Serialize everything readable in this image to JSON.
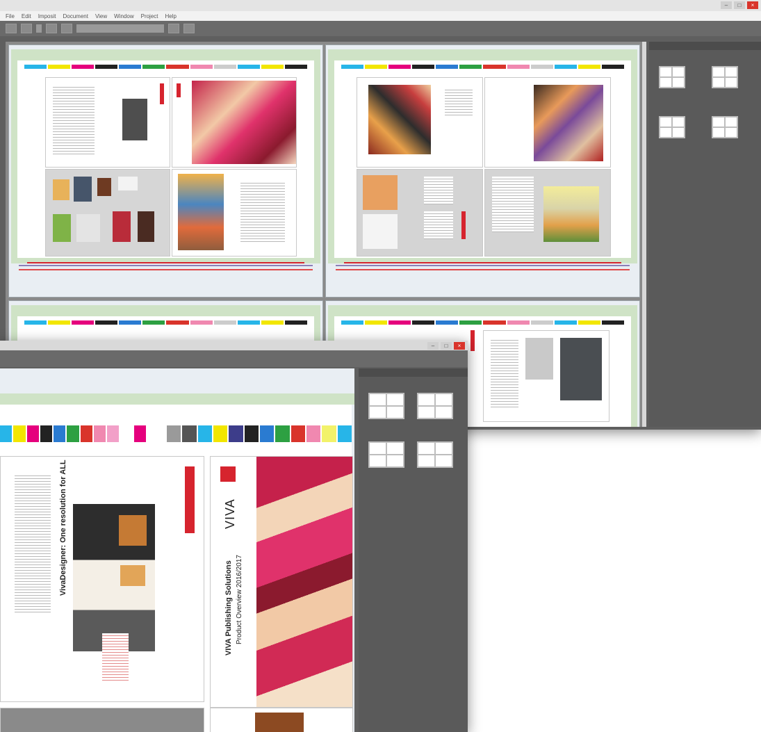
{
  "back_window": {
    "title": "",
    "menu": [
      "File",
      "Edit",
      "Imposit",
      "Document",
      "View",
      "Window",
      "Project",
      "Help"
    ],
    "toolbar": {
      "zoom": "",
      "document": ""
    },
    "panel": {
      "title": "",
      "layouts": [
        {
          "label": "",
          "cells": [
            "",
            "",
            "",
            ""
          ]
        },
        {
          "label": "",
          "cells": [
            "",
            "",
            "",
            ""
          ]
        },
        {
          "label": "",
          "cells": [
            "",
            "",
            "",
            ""
          ]
        },
        {
          "label": "",
          "cells": [
            "",
            "",
            "",
            ""
          ]
        }
      ]
    },
    "sheet_info": [
      "",
      ""
    ]
  },
  "front_window": {
    "title": "",
    "panel": {
      "title": "",
      "layouts": [
        {
          "label": "",
          "cells": [
            "",
            "",
            "",
            ""
          ]
        },
        {
          "label": "",
          "cells": [
            "",
            "",
            "",
            ""
          ]
        },
        {
          "label": "",
          "cells": [
            "",
            "",
            "",
            ""
          ]
        },
        {
          "label": "",
          "cells": [
            "",
            "",
            "",
            ""
          ]
        }
      ]
    },
    "page_text": {
      "heading": "VivaDesigner: One resolution for ALL",
      "logo": "VIVA",
      "cover_title": "VIVA Publishing Solutions",
      "cover_subtitle": "Product Overview 2016/2017"
    }
  },
  "colors": {
    "app_gray": "#5f5f5f",
    "sheet_green": "#cfe3c6",
    "sheet_blue": "#e9eef3",
    "accent_red": "#d6242e",
    "close_red": "#d9342b"
  },
  "colorbar_colors": [
    "#27b5e8",
    "#f2e600",
    "#e5007d",
    "#222222",
    "#2a7bd1",
    "#2da042",
    "#d9342b",
    "#f088b0",
    "#9a9a9a",
    "#555555",
    "#2ab0e0",
    "#f0e000"
  ]
}
